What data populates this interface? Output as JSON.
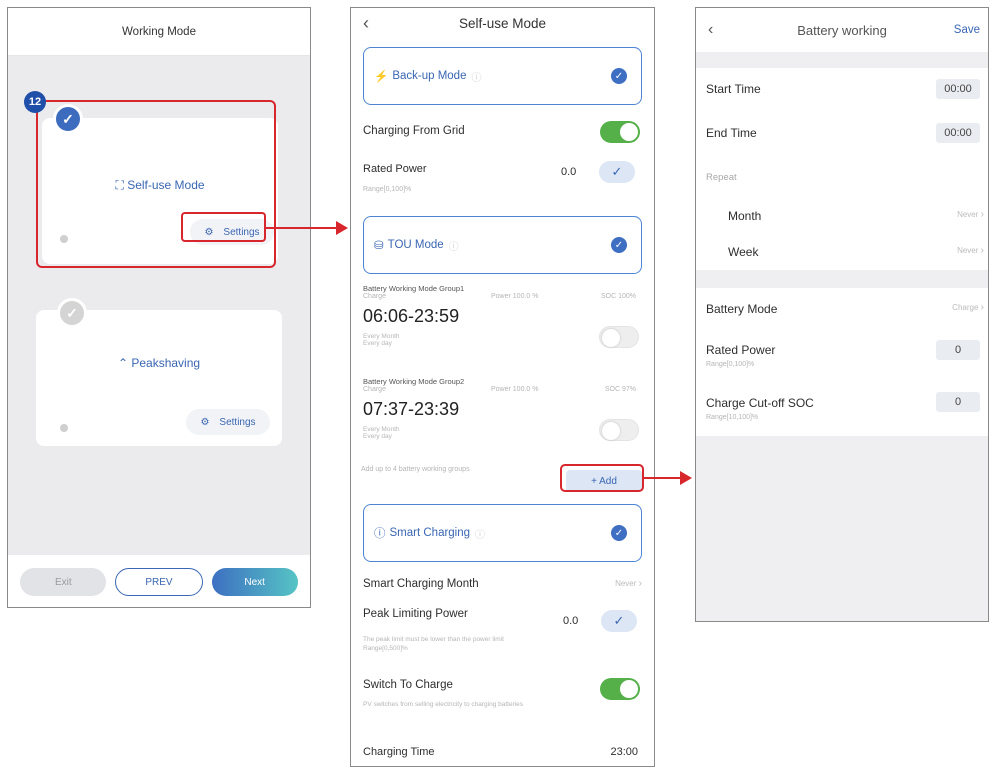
{
  "step_number": "12",
  "colors": {
    "accent_red": "#d8262d",
    "primary_blue": "#3a66b3",
    "toggle_green": "#55b04a"
  },
  "screen1": {
    "title": "Working Mode",
    "self_use": {
      "label": "Self-use Mode",
      "settings": "Settings",
      "icon": "self-use-icon"
    },
    "peak": {
      "label": "Peakshaving",
      "settings": "Settings",
      "icon": "peakshaving-icon"
    },
    "buttons": {
      "exit": "Exit",
      "prev": "PREV",
      "next": "Next"
    }
  },
  "screen2": {
    "title": "Self-use Mode",
    "backup_mode": "Back-up Mode",
    "charging_from_grid": "Charging From Grid",
    "rated_power": {
      "label": "Rated Power",
      "value": "0.0",
      "range": "Range[0,100]%"
    },
    "tou_mode": "TOU Mode",
    "groups": [
      {
        "title": "Battery Working Mode Group1",
        "mode": "Charge",
        "power": "Power 100.0 %",
        "soc": "SOC 100%",
        "time": "06:06-23:59",
        "month": "Every Month",
        "day": "Every day"
      },
      {
        "title": "Battery Working Mode Group2",
        "mode": "Charge",
        "power": "Power 100.0 %",
        "soc": "SOC 97%",
        "time": "07:37-23:39",
        "month": "Every Month",
        "day": "Every day"
      }
    ],
    "add_hint": "Add up to 4 battery working groups",
    "add_button": "+ Add",
    "smart_charging": "Smart Charging",
    "smart_charging_month": {
      "label": "Smart Charging Month",
      "value": "Never"
    },
    "peak_limiting_power": {
      "label": "Peak Limiting Power",
      "value": "0.0",
      "note": "The peak limit must be lower than the power limit",
      "range": "Range[0,500]%"
    },
    "switch_to_charge": {
      "label": "Switch To Charge",
      "note": "PV switches from selling electricity to charging batteries"
    },
    "charging_time": {
      "label": "Charging Time",
      "value": "23:00"
    }
  },
  "screen3": {
    "title": "Battery working",
    "save": "Save",
    "start_time": {
      "label": "Start Time",
      "value": "00:00"
    },
    "end_time": {
      "label": "End Time",
      "value": "00:00"
    },
    "repeat": "Repeat",
    "month": {
      "label": "Month",
      "value": "Never"
    },
    "week": {
      "label": "Week",
      "value": "Never"
    },
    "battery_mode": {
      "label": "Battery Mode",
      "value": "Charge"
    },
    "rated_power": {
      "label": "Rated Power",
      "range": "Range[0,100]%",
      "value": "0"
    },
    "cutoff_soc": {
      "label": "Charge Cut-off SOC",
      "range": "Range[10,100]%",
      "value": "0"
    }
  }
}
